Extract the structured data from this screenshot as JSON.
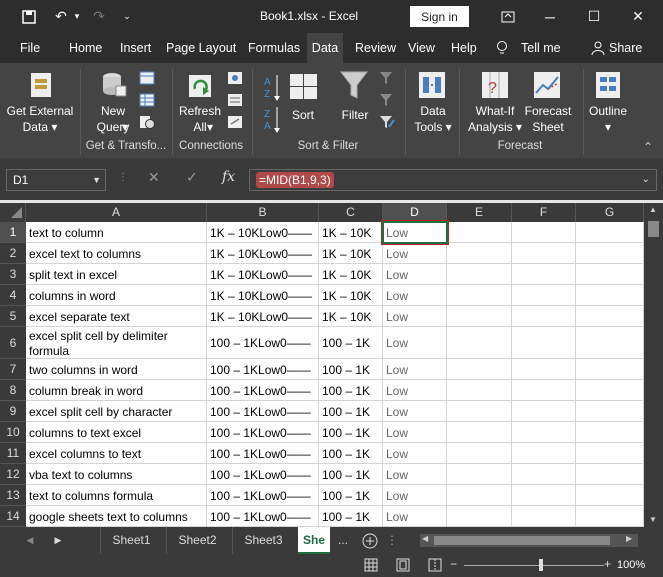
{
  "window": {
    "title": "Book1.xlsx - Excel",
    "signin": "Sign in"
  },
  "tabs": [
    "File",
    "Home",
    "Insert",
    "Page Layout",
    "Formulas",
    "Data",
    "Review",
    "View",
    "Help"
  ],
  "tabs_extra": {
    "tellme": "Tell me",
    "share": "Share"
  },
  "ribbon": {
    "get_external": "Get External Data",
    "new_query": "New Query",
    "refresh_all": "Refresh All",
    "sort": "Sort",
    "filter": "Filter",
    "data_tools": "Data Tools",
    "what_if": "What-If Analysis",
    "forecast_sheet": "Forecast Sheet",
    "outline": "Outline",
    "groups": [
      "Get & Transfo...",
      "Connections",
      "Sort & Filter",
      "Forecast"
    ]
  },
  "formula_bar": {
    "name_box": "D1",
    "fx": "fx",
    "formula": "=MID(B1,9,3)"
  },
  "columns": [
    "A",
    "B",
    "C",
    "D",
    "E",
    "F",
    "G"
  ],
  "rows": [
    {
      "n": "1",
      "a": "text to column",
      "b": "1K – 10KLow0——",
      "c": "1K – 10K",
      "d": "Low"
    },
    {
      "n": "2",
      "a": "excel text to columns",
      "b": "1K – 10KLow0——",
      "c": "1K – 10K",
      "d": "Low"
    },
    {
      "n": "3",
      "a": "split text in excel",
      "b": "1K – 10KLow0——",
      "c": "1K – 10K",
      "d": "Low"
    },
    {
      "n": "4",
      "a": "columns in word",
      "b": "1K – 10KLow0——",
      "c": "1K – 10K",
      "d": "Low"
    },
    {
      "n": "5",
      "a": "excel separate text",
      "b": "1K – 10KLow0——",
      "c": "1K – 10K",
      "d": "Low"
    },
    {
      "n": "6",
      "a": "excel split cell by delimiter formula",
      "b": "100 – 1KLow0——",
      "c": "100 – 1K",
      "d": "Low"
    },
    {
      "n": "7",
      "a": "two columns in word",
      "b": "100 – 1KLow0——",
      "c": "100 – 1K",
      "d": "Low"
    },
    {
      "n": "8",
      "a": "column break in word",
      "b": "100 – 1KLow0——",
      "c": "100 – 1K",
      "d": "Low"
    },
    {
      "n": "9",
      "a": "excel split cell by character",
      "b": "100 – 1KLow0——",
      "c": "100 – 1K",
      "d": "Low"
    },
    {
      "n": "10",
      "a": "columns to text excel",
      "b": "100 – 1KLow0——",
      "c": "100 – 1K",
      "d": "Low"
    },
    {
      "n": "11",
      "a": "excel columns to text",
      "b": "100 – 1KLow0——",
      "c": "100 – 1K",
      "d": "Low"
    },
    {
      "n": "12",
      "a": "vba text to columns",
      "b": "100 – 1KLow0——",
      "c": "100 – 1K",
      "d": "Low"
    },
    {
      "n": "13",
      "a": "text to columns formula",
      "b": "100 – 1KLow0——",
      "c": "100 – 1K",
      "d": "Low"
    },
    {
      "n": "14",
      "a": "google sheets text to columns",
      "b": "100 – 1KLow0——",
      "c": "100 – 1K",
      "d": "Low"
    }
  ],
  "sheets": [
    "Sheet1",
    "Sheet2",
    "Sheet3",
    "She"
  ],
  "sheets_more": "...",
  "status": {
    "zoom": "100%"
  }
}
